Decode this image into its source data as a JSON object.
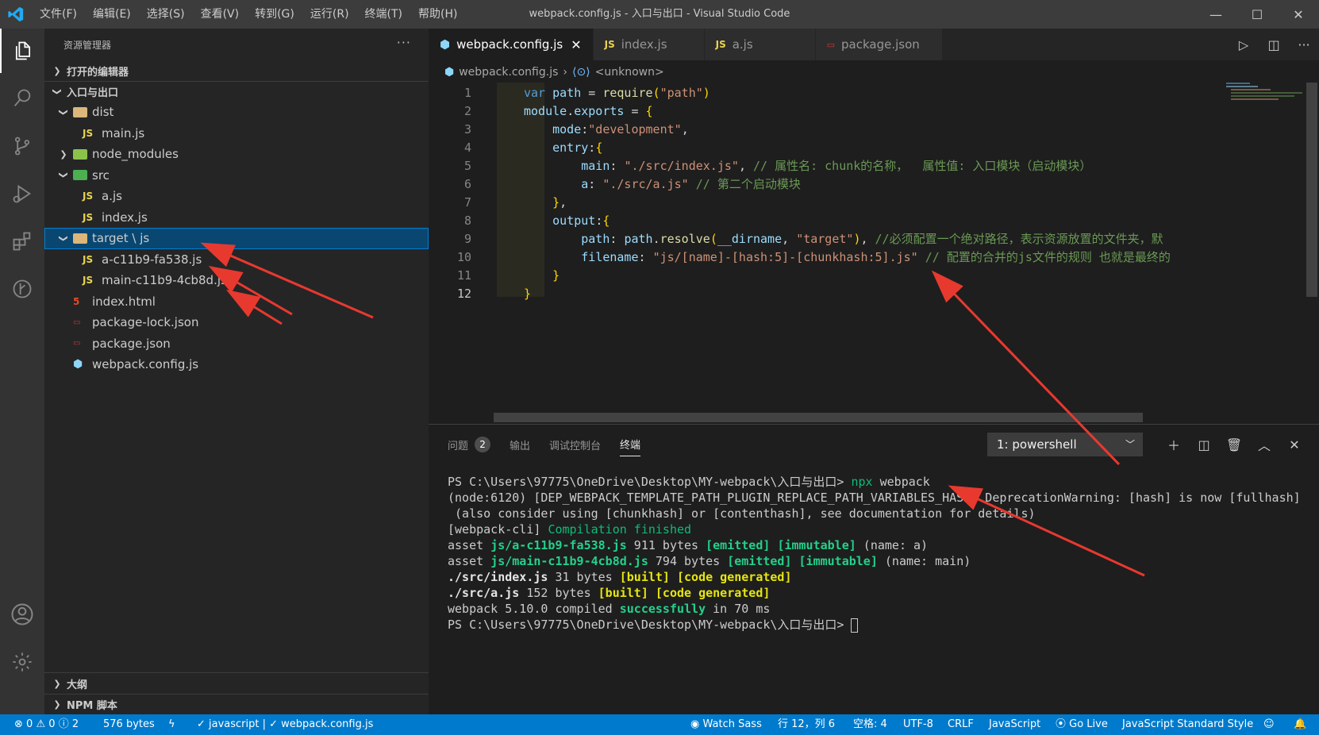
{
  "titlebar": {
    "menus": [
      "文件(F)",
      "编辑(E)",
      "选择(S)",
      "查看(V)",
      "转到(G)",
      "运行(R)",
      "终端(T)",
      "帮助(H)"
    ],
    "title": "webpack.config.js - 入口与出口 - Visual Studio Code"
  },
  "sidebar": {
    "header": "资源管理器",
    "more": "···",
    "open_editors": "打开的编辑器",
    "project": "入口与出口",
    "tree": [
      {
        "label": "dist"
      },
      {
        "label": "main.js"
      },
      {
        "label": "node_modules"
      },
      {
        "label": "src"
      },
      {
        "label": "a.js"
      },
      {
        "label": "index.js"
      },
      {
        "label": "target \\ js"
      },
      {
        "label": "a-c11b9-fa538.js"
      },
      {
        "label": "main-c11b9-4cb8d.js"
      },
      {
        "label": "index.html"
      },
      {
        "label": "package-lock.json"
      },
      {
        "label": "package.json"
      },
      {
        "label": "webpack.config.js"
      }
    ],
    "outline": "大纲",
    "npm_scripts": "NPM 脚本"
  },
  "tabs": [
    {
      "label": "webpack.config.js",
      "icon": "JS"
    },
    {
      "label": "index.js",
      "icon": "JS"
    },
    {
      "label": "a.js",
      "icon": "JS"
    },
    {
      "label": "package.json",
      "icon": "json"
    }
  ],
  "breadcrumb": {
    "file": "webpack.config.js",
    "symbol": "<unknown>"
  },
  "code": {
    "lines": [
      {
        "n": "1",
        "tokens": [
          [
            "kw",
            "var "
          ],
          [
            "vr",
            "path "
          ],
          [
            "pu",
            "= "
          ],
          [
            "fn",
            "require"
          ],
          [
            "br",
            "("
          ],
          [
            "st",
            "\"path\""
          ],
          [
            "br",
            ")"
          ]
        ]
      },
      {
        "n": "2",
        "tokens": [
          [
            "vr",
            "module"
          ],
          [
            "pu",
            "."
          ],
          [
            "vr",
            "exports "
          ],
          [
            "pu",
            "= "
          ],
          [
            "br",
            "{"
          ]
        ]
      },
      {
        "n": "3",
        "tokens": [
          [
            "pu",
            "    "
          ],
          [
            "vr",
            "mode"
          ],
          [
            "pu",
            ":"
          ],
          [
            "st",
            "\"development\""
          ],
          [
            "pu",
            ","
          ]
        ]
      },
      {
        "n": "4",
        "tokens": [
          [
            "pu",
            "    "
          ],
          [
            "vr",
            "entry"
          ],
          [
            "pu",
            ":"
          ],
          [
            "br",
            "{"
          ]
        ]
      },
      {
        "n": "5",
        "tokens": [
          [
            "pu",
            "        "
          ],
          [
            "vr",
            "main"
          ],
          [
            "pu",
            ": "
          ],
          [
            "st",
            "\"./src/index.js\""
          ],
          [
            "pu",
            ", "
          ],
          [
            "cm",
            "// 属性名: chunk的名称，  属性值: 入口模块（启动模块）"
          ]
        ]
      },
      {
        "n": "6",
        "tokens": [
          [
            "pu",
            "        "
          ],
          [
            "vr",
            "a"
          ],
          [
            "pu",
            ": "
          ],
          [
            "st",
            "\"./src/a.js\""
          ],
          [
            "pu",
            " "
          ],
          [
            "cm",
            "// 第二个启动模块"
          ]
        ]
      },
      {
        "n": "7",
        "tokens": [
          [
            "pu",
            "    "
          ],
          [
            "br",
            "}"
          ],
          [
            "pu",
            ","
          ]
        ]
      },
      {
        "n": "8",
        "tokens": [
          [
            "pu",
            "    "
          ],
          [
            "vr",
            "output"
          ],
          [
            "pu",
            ":"
          ],
          [
            "br",
            "{"
          ]
        ]
      },
      {
        "n": "9",
        "tokens": [
          [
            "pu",
            "        "
          ],
          [
            "vr",
            "path"
          ],
          [
            "pu",
            ": "
          ],
          [
            "vr",
            "path"
          ],
          [
            "pu",
            "."
          ],
          [
            "fn",
            "resolve"
          ],
          [
            "br",
            "("
          ],
          [
            "vr",
            "__dirname"
          ],
          [
            "pu",
            ", "
          ],
          [
            "st",
            "\"target\""
          ],
          [
            "br",
            ")"
          ],
          [
            "pu",
            ", "
          ],
          [
            "cm",
            "//必须配置一个绝对路径，表示资源放置的文件夹，默"
          ]
        ]
      },
      {
        "n": "10",
        "tokens": [
          [
            "pu",
            "        "
          ],
          [
            "vr",
            "filename"
          ],
          [
            "pu",
            ": "
          ],
          [
            "st",
            "\"js/[name]-[hash:5]-[chunkhash:5].js\""
          ],
          [
            "pu",
            " "
          ],
          [
            "cm",
            "// 配置的合并的js文件的规则 也就是最终的"
          ]
        ]
      },
      {
        "n": "11",
        "tokens": [
          [
            "pu",
            "    "
          ],
          [
            "br",
            "}"
          ]
        ]
      },
      {
        "n": "12",
        "tokens": [
          [
            "br",
            "}"
          ]
        ]
      }
    ]
  },
  "panel": {
    "tabs": [
      "问题",
      "输出",
      "调试控制台",
      "终端"
    ],
    "problems_count": "2",
    "terminal_select": "1: powershell",
    "terminal_lines": [
      [
        [
          "",
          "PS C:\\Users\\97775\\OneDrive\\Desktop\\MY-webpack\\入口与出口> "
        ],
        [
          "tg",
          "npx"
        ],
        [
          "",
          " webpack"
        ]
      ],
      [
        [
          "",
          "(node:6120) [DEP_WEBPACK_TEMPLATE_PATH_PLUGIN_REPLACE_PATH_VARIABLES_HASH] DeprecationWarning: [hash] is now [fullhash]"
        ]
      ],
      [
        [
          "",
          " (also consider using [chunkhash] or [contenthash], see documentation for details)"
        ]
      ],
      [
        [
          "",
          "[webpack-cli] "
        ],
        [
          "tg",
          "Compilation finished"
        ]
      ],
      [
        [
          "",
          "asset "
        ],
        [
          "tgb",
          "js/a-c11b9-fa538.js"
        ],
        [
          "",
          " 911 bytes "
        ],
        [
          "tgb",
          "[emitted]"
        ],
        [
          "",
          " "
        ],
        [
          "tgb",
          "[immutable]"
        ],
        [
          "",
          " (name: a)"
        ]
      ],
      [
        [
          "",
          "asset "
        ],
        [
          "tgb",
          "js/main-c11b9-4cb8d.js"
        ],
        [
          "",
          " 794 bytes "
        ],
        [
          "tgb",
          "[emitted]"
        ],
        [
          "",
          " "
        ],
        [
          "tgb",
          "[immutable]"
        ],
        [
          "",
          " (name: main)"
        ]
      ],
      [
        [
          "tb",
          "./src/index.js"
        ],
        [
          "",
          " 31 bytes "
        ],
        [
          "ty",
          "[built]"
        ],
        [
          "",
          " "
        ],
        [
          "ty",
          "[code generated]"
        ]
      ],
      [
        [
          "tb",
          "./src/a.js"
        ],
        [
          "",
          " 152 bytes "
        ],
        [
          "ty",
          "[built]"
        ],
        [
          "",
          " "
        ],
        [
          "ty",
          "[code generated]"
        ]
      ],
      [
        [
          "",
          "webpack 5.10.0 compiled "
        ],
        [
          "tgb",
          "successfully"
        ],
        [
          "",
          " in 70 ms"
        ]
      ],
      [
        [
          "",
          "PS C:\\Users\\97775\\OneDrive\\Desktop\\MY-webpack\\入口与出口> "
        ]
      ]
    ]
  },
  "statusbar": {
    "errors": "0",
    "warnings": "0",
    "info": "2",
    "filesize": "576 bytes",
    "lint": "✓ javascript | ✓ webpack.config.js",
    "watch_sass": "Watch Sass",
    "position": "行 12，列 6",
    "spaces": "空格: 4",
    "encoding": "UTF-8",
    "eol": "CRLF",
    "language": "JavaScript",
    "golive": "Go Live",
    "style": "JavaScript Standard Style"
  },
  "colors": {
    "accent": "#007acc",
    "selection": "#094771",
    "annotation_arrow": "#e8392f"
  }
}
